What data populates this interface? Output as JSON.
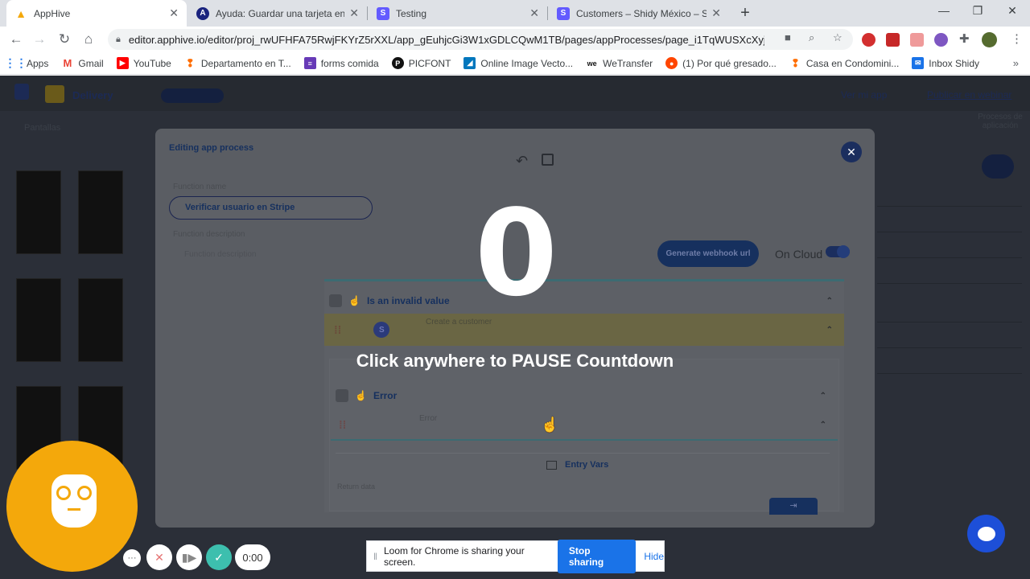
{
  "browser": {
    "tabs": [
      {
        "title": "AppHive",
        "active": true,
        "favicon_color": "#f4a80b"
      },
      {
        "title": "Ayuda: Guardar una tarjeta en Str",
        "active": false,
        "favicon_color": "#1a237e"
      },
      {
        "title": "Testing",
        "active": false,
        "favicon_color": "#635bff"
      },
      {
        "title": "Customers – Shidy México – Strip",
        "active": false,
        "favicon_color": "#635bff"
      }
    ],
    "url": "editor.apphive.io/editor/proj_rwUFHFA75RwjFKYrZ5rXXL/app_gEuhjcGi3W1xGDLCQwM1TB/pages/appProcesses/page_i1TqWUSXcXyjB...",
    "bookmarks": [
      {
        "label": "Apps",
        "icon": "apps-grid-icon"
      },
      {
        "label": "Gmail",
        "icon": "gmail-icon"
      },
      {
        "label": "YouTube",
        "icon": "youtube-icon"
      },
      {
        "label": "Departamento en T...",
        "icon": "pin-icon"
      },
      {
        "label": "forms comida",
        "icon": "forms-icon"
      },
      {
        "label": "PICFONT",
        "icon": "pinterest-icon"
      },
      {
        "label": "Online Image Vecto...",
        "icon": "vector-icon"
      },
      {
        "label": "WeTransfer",
        "icon": "wetransfer-icon"
      },
      {
        "label": "(1) Por qué gresado...",
        "icon": "reddit-icon"
      },
      {
        "label": "Casa en Condomini...",
        "icon": "pin-icon"
      },
      {
        "label": "Inbox Shidy",
        "icon": "mail-icon"
      }
    ]
  },
  "app": {
    "project_name": "Delivery",
    "header_right": "Ver mi app",
    "header_link": "Publicar en webinar",
    "sidebar_label": "Pantallas",
    "right_label": "Procesos de aplicación"
  },
  "modal": {
    "title": "Editing app process",
    "function_name_label": "Function name",
    "function_name": "Verificar usuario en Stripe",
    "function_description_label": "Function description",
    "function_description_placeholder": "Function description",
    "webhook_button": "Generate webhook url",
    "on_cloud_label": "On Cloud",
    "sections": {
      "invalid_value": "Is an invalid value",
      "create_customer": "Create a customer",
      "error": "Error",
      "error_sub": "Error",
      "entry_vars": "Entry Vars",
      "return_data": "Return data"
    }
  },
  "overlay": {
    "countdown": "0",
    "message": "Click anywhere to PAUSE Countdown"
  },
  "loom": {
    "timer": "0:00",
    "share_text": "Loom for Chrome is sharing your screen.",
    "stop_button": "Stop sharing",
    "hide_button": "Hide"
  }
}
